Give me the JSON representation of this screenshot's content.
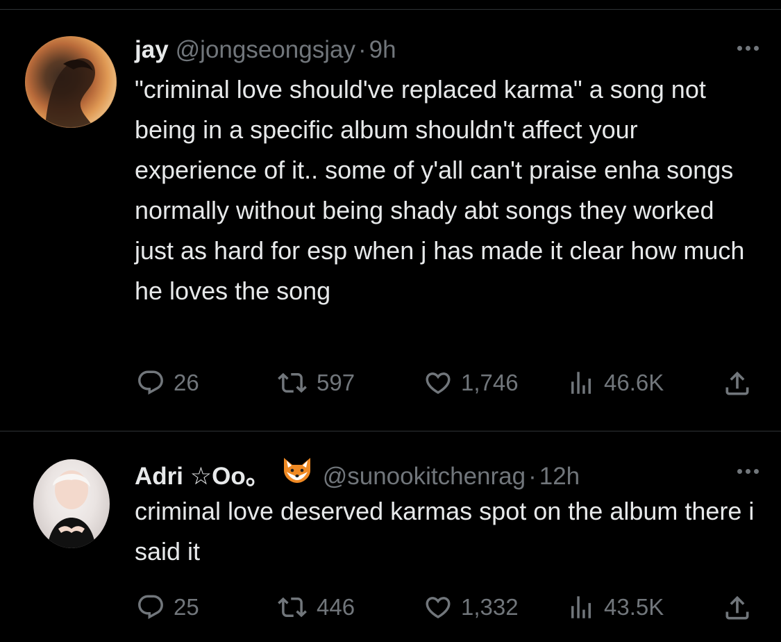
{
  "tweets": [
    {
      "name": "jay",
      "handle": "@jongseongsjay",
      "separator": "·",
      "time": "9h",
      "text": "\"criminal love should've replaced karma\" a song not being in a specific album shouldn't affect your experience of it.. some of y'all can't praise enha songs normally without being shady abt songs they worked just as hard for esp when j has made it clear how much he loves the song",
      "replies": "26",
      "reposts": "597",
      "likes": "1,746",
      "views": "46.6K"
    },
    {
      "name": "Adri ☆Oo。",
      "name_emoji": "fox-face-emoji",
      "handle": "@sunookitchenrag",
      "separator": "·",
      "time": "12h",
      "text": "criminal love deserved karmas spot on the album there i said it",
      "replies": "25",
      "reposts": "446",
      "likes": "1,332",
      "views": "43.5K"
    }
  ],
  "icons": [
    "reply-icon",
    "repost-icon",
    "like-icon",
    "views-icon",
    "share-icon",
    "more-icon"
  ],
  "colors": {
    "background": "#000000",
    "text": "#e7e9ea",
    "muted": "#71767b",
    "divider": "#2f3336"
  }
}
